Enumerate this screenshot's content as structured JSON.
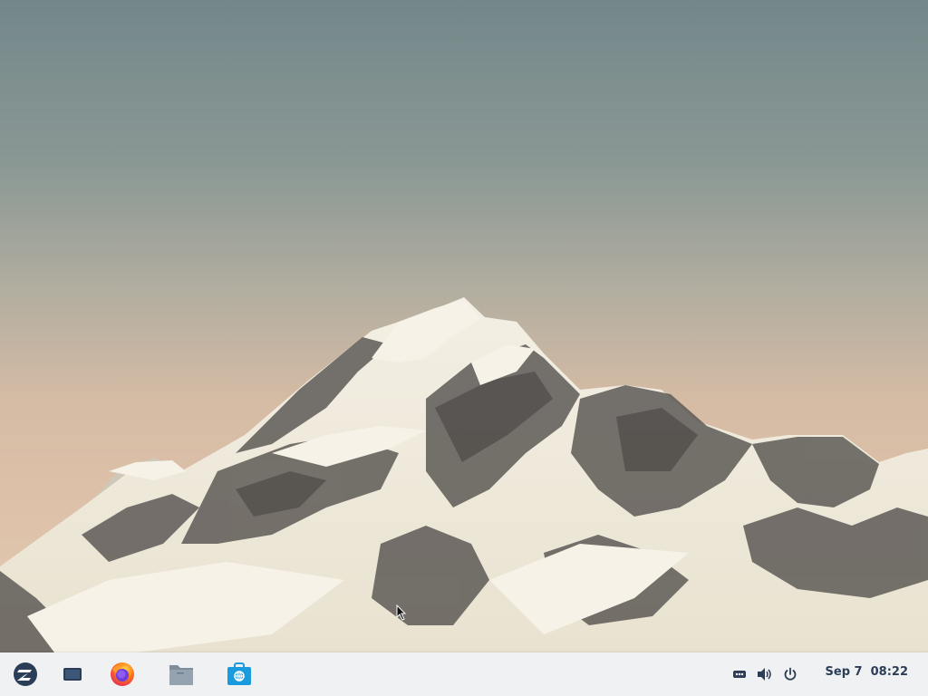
{
  "desktop": {
    "wallpaper": "snowy-mountain-peak",
    "sky_top": "#73878a",
    "sky_bottom": "#e4cbb2"
  },
  "taskbar": {
    "apps": [
      {
        "name": "zorin-menu-icon"
      },
      {
        "name": "workspace-switcher-icon"
      },
      {
        "name": "firefox-icon"
      },
      {
        "name": "files-folder-icon"
      },
      {
        "name": "software-store-icon"
      }
    ],
    "tray": [
      {
        "name": "network-icon"
      },
      {
        "name": "volume-icon"
      },
      {
        "name": "power-icon"
      }
    ],
    "clock": {
      "date": "Sep 7",
      "time": "08:22"
    },
    "accent": "#1a9bdd"
  }
}
